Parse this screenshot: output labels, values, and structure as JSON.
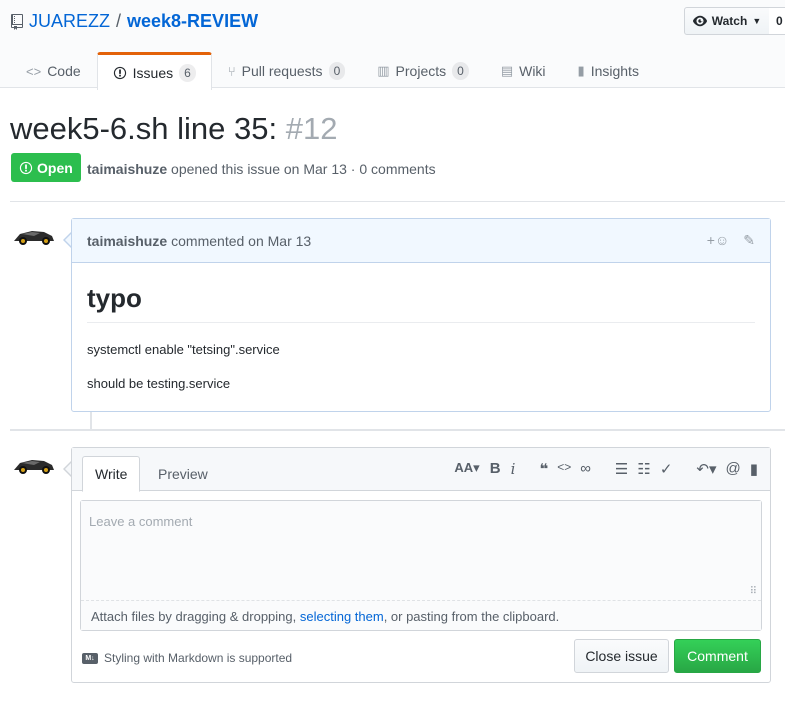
{
  "repo": {
    "owner": "JUAREZZ",
    "separator": "/",
    "name": "week8-REVIEW"
  },
  "watch": {
    "label": "Watch",
    "count": "0"
  },
  "tabs": [
    {
      "label": "Code",
      "icon": "code-icon"
    },
    {
      "label": "Issues",
      "count": "6",
      "icon": "issue-icon"
    },
    {
      "label": "Pull requests",
      "count": "0",
      "icon": "pull-request-icon"
    },
    {
      "label": "Projects",
      "count": "0",
      "icon": "project-icon"
    },
    {
      "label": "Wiki",
      "icon": "book-icon"
    },
    {
      "label": "Insights",
      "icon": "graph-icon"
    }
  ],
  "issue": {
    "title": "week5-6.sh line 35:",
    "number": "#12",
    "state": "Open",
    "author": "taimaishuze",
    "meta_text": "opened this issue on Mar 13 · 0 comments"
  },
  "comment": {
    "author": "taimaishuze",
    "timestamp": "commented on Mar 13",
    "heading": "typo",
    "paragraphs": [
      "systemctl enable \"tetsing\".service",
      "should be testing.service"
    ]
  },
  "form": {
    "write_tab": "Write",
    "preview_tab": "Preview",
    "placeholder": "Leave a comment",
    "attach_prefix": "Attach files by dragging & dropping, ",
    "attach_link": "selecting them",
    "attach_suffix": ", or pasting from the clipboard.",
    "markdown_note": "Styling with Markdown is supported",
    "close_button": "Close issue",
    "comment_button": "Comment"
  },
  "colors": {
    "open": "#2cbe4e",
    "link": "#0366d6",
    "tab_accent": "#e36209",
    "comment_button": "#28a745"
  }
}
